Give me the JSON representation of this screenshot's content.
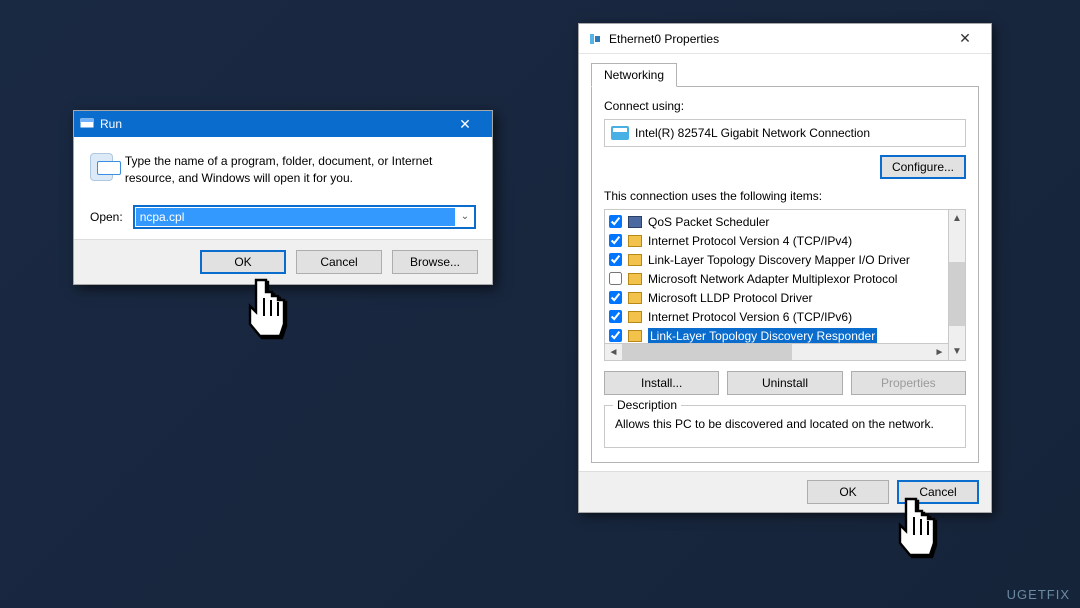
{
  "run": {
    "title": "Run",
    "description": "Type the name of a program, folder, document, or Internet resource, and Windows will open it for you.",
    "open_label": "Open:",
    "input_value": "ncpa.cpl",
    "buttons": {
      "ok": "OK",
      "cancel": "Cancel",
      "browse": "Browse..."
    }
  },
  "props": {
    "title": "Ethernet0 Properties",
    "tab": "Networking",
    "connect_using_label": "Connect using:",
    "adapter": "Intel(R) 82574L Gigabit Network Connection",
    "configure": "Configure...",
    "items_label": "This connection uses the following items:",
    "items": [
      {
        "checked": true,
        "icon": "qos",
        "label": "QoS Packet Scheduler"
      },
      {
        "checked": true,
        "icon": "net",
        "label": "Internet Protocol Version 4 (TCP/IPv4)"
      },
      {
        "checked": true,
        "icon": "net",
        "label": "Link-Layer Topology Discovery Mapper I/O Driver"
      },
      {
        "checked": false,
        "icon": "net",
        "label": "Microsoft Network Adapter Multiplexor Protocol"
      },
      {
        "checked": true,
        "icon": "net",
        "label": "Microsoft LLDP Protocol Driver"
      },
      {
        "checked": true,
        "icon": "net",
        "label": "Internet Protocol Version 6 (TCP/IPv6)"
      },
      {
        "checked": true,
        "icon": "net",
        "label": "Link-Layer Topology Discovery Responder",
        "selected": true
      }
    ],
    "actions": {
      "install": "Install...",
      "uninstall": "Uninstall",
      "properties": "Properties"
    },
    "description_legend": "Description",
    "description_text": "Allows this PC to be discovered and located on the network.",
    "footer": {
      "ok": "OK",
      "cancel": "Cancel"
    }
  },
  "watermark": "UGETFIX"
}
